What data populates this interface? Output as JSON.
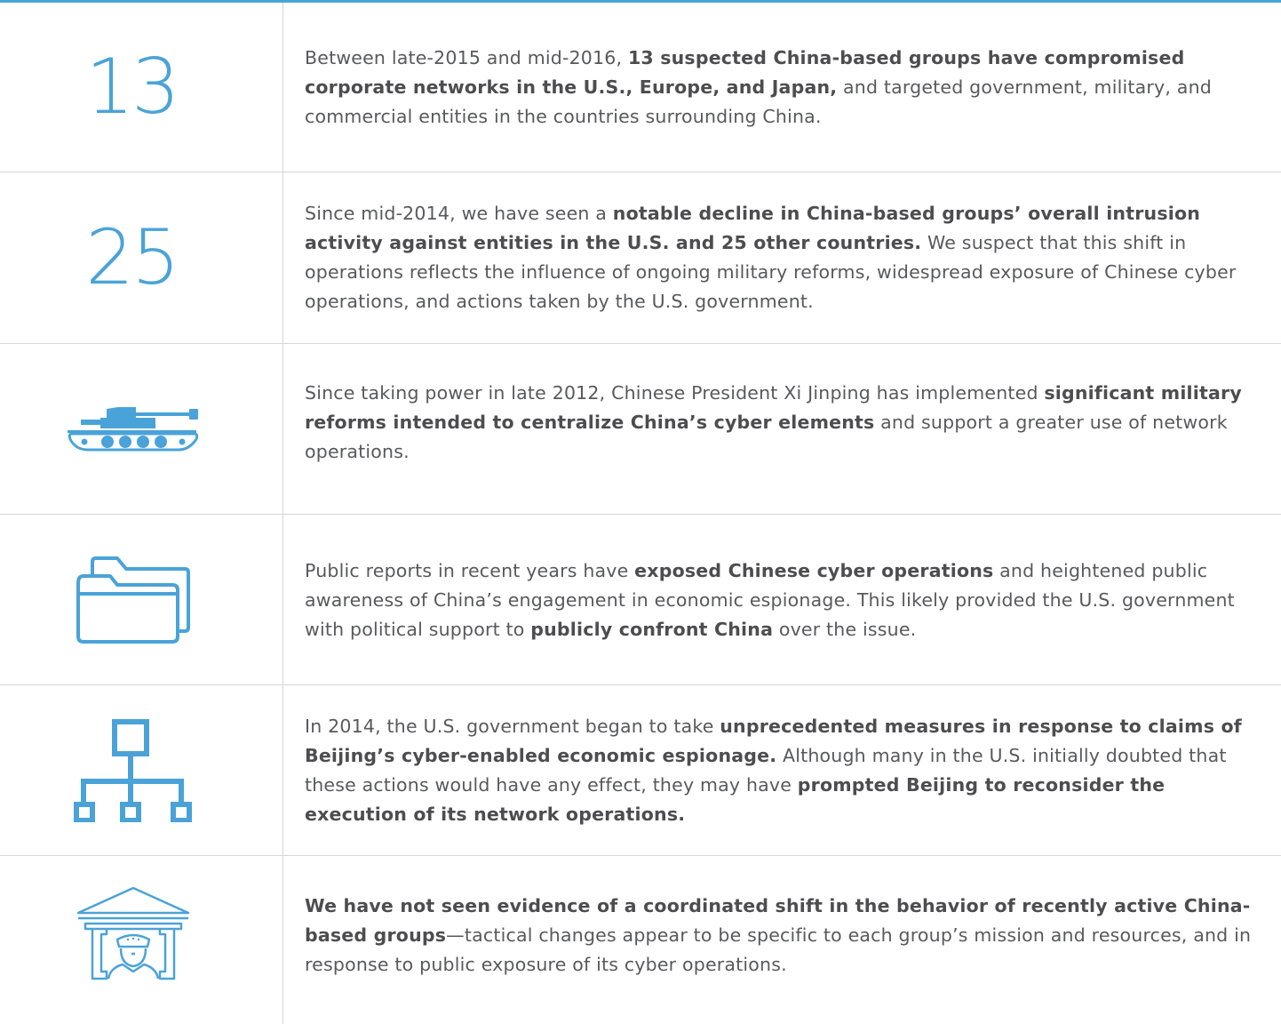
{
  "colors": {
    "accent": "#4aa3d8",
    "text": "#58595b",
    "rule": "#d5d5d5"
  },
  "rows": [
    {
      "stat": "13",
      "seg": [
        "Between late-2015 and mid-2016, ",
        "13 suspected China-based groups have compromised corporate networks in the U.S., Europe, and Japan,",
        " and targeted government, military, and commercial entities in the countries surrounding China."
      ]
    },
    {
      "stat": "25",
      "seg": [
        "Since mid-2014, we have seen a ",
        "notable decline in China-based groups’ overall intrusion activity against entities in the U.S. and 25 other countries.",
        " We suspect that this shift in operations reflects the influence of ongoing military reforms, widespread exposure of Chinese cyber operations, and actions taken by the U.S. government."
      ]
    },
    {
      "icon": "tank-icon",
      "seg": [
        "Since taking power in late 2012, Chinese President Xi Jinping has implemented ",
        "significant military reforms intended to centralize China’s cyber elements",
        " and support a greater use of network operations."
      ]
    },
    {
      "icon": "folder-icon",
      "seg": [
        "Public reports in recent years have ",
        "exposed Chinese cyber operations",
        " and heightened public awareness of China’s engagement in economic espionage. This likely provided the U.S. government with political support to ",
        "publicly confront China",
        " over the issue."
      ]
    },
    {
      "icon": "org-chart-icon",
      "seg": [
        "In 2014, the U.S. government began to take ",
        "unprecedented measures in response to claims of Beijing’s cyber-enabled economic espionage.",
        " Although many in the U.S. initially doubted that these actions would have any effect, they may have ",
        "prompted Beijing to reconsider the execution of its network operations."
      ]
    },
    {
      "icon": "government-soldier-icon",
      "seg": [
        "",
        "We have not seen evidence of a coordinated shift in the behavior of recently active China-based groups",
        "—tactical changes appear to be specific to each group’s mission and resources, and in response to public exposure of its cyber operations."
      ]
    }
  ]
}
